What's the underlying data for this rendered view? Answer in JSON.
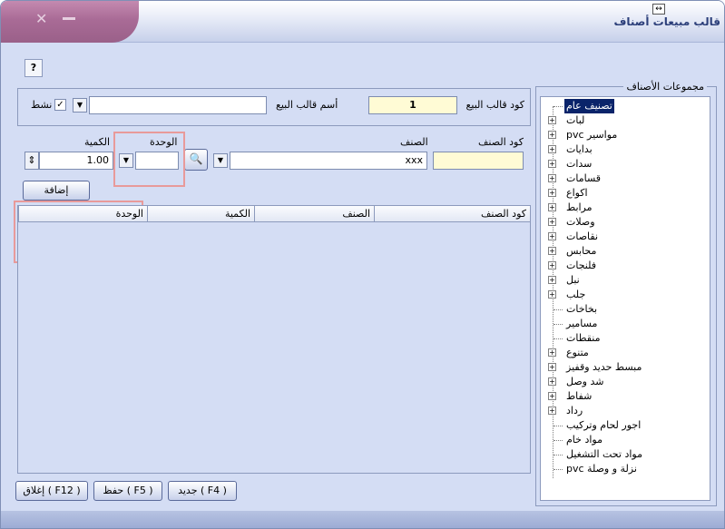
{
  "window": {
    "title": "قالب مبيعات أصناف"
  },
  "help_label": "?",
  "header": {
    "template_code_label": "كود قالب البيع",
    "template_code_value": "1",
    "template_name_label": "أسم قالب البيع",
    "template_name_value": "",
    "active_label": "نشط",
    "active_checked": true,
    "active_check_glyph": "✓"
  },
  "entry": {
    "item_code_label": "كود الصنف",
    "item_code_value": "",
    "item_label": "الصنف",
    "item_value": "xxx",
    "unit_label": "الوحدة",
    "unit_value": "",
    "qty_label": "الكمية",
    "qty_value": "1.00",
    "add_button": "إضافة"
  },
  "grid": {
    "columns": [
      "كود الصنف",
      "الصنف",
      "الكمية",
      "الوحدة"
    ],
    "rows": []
  },
  "groups": {
    "title": "مجموعات الأصناف",
    "items": [
      {
        "label": "تصنيف عام",
        "expandable": false,
        "selected": true
      },
      {
        "label": "لبات",
        "expandable": true
      },
      {
        "label": "مواسير pvc",
        "expandable": true
      },
      {
        "label": "بدايات",
        "expandable": true
      },
      {
        "label": "سدات",
        "expandable": true
      },
      {
        "label": "قسامات",
        "expandable": true
      },
      {
        "label": "اكواع",
        "expandable": true
      },
      {
        "label": "مرابط",
        "expandable": true
      },
      {
        "label": "وصلات",
        "expandable": true
      },
      {
        "label": "نقاصات",
        "expandable": true
      },
      {
        "label": "محابس",
        "expandable": true
      },
      {
        "label": "فلنجات",
        "expandable": true
      },
      {
        "label": "نبل",
        "expandable": true
      },
      {
        "label": "جلب",
        "expandable": true
      },
      {
        "label": "بخاخات",
        "expandable": false
      },
      {
        "label": "مسامير",
        "expandable": false
      },
      {
        "label": "منقطات",
        "expandable": false
      },
      {
        "label": "متنوع",
        "expandable": true
      },
      {
        "label": "مبسط حديد وقفيز",
        "expandable": true
      },
      {
        "label": "شد وصل",
        "expandable": true
      },
      {
        "label": "شفاط",
        "expandable": true
      },
      {
        "label": "رداد",
        "expandable": true
      },
      {
        "label": "اجور لحام وتركيب",
        "expandable": false
      },
      {
        "label": "مواد خام",
        "expandable": false
      },
      {
        "label": "مواد تحت التشغيل",
        "expandable": false
      },
      {
        "label": "نزلة و وصلة pvc",
        "expandable": false
      }
    ]
  },
  "footer": {
    "new_button": "جديد ( F4 )",
    "save_button": "حفظ ( F5 )",
    "close_button": "إغلاق ( F12 )"
  },
  "icons": {
    "dropdown": "▼",
    "search": "🔍",
    "spinner": "⇕",
    "resize": "↔",
    "close": "✕",
    "expand": "+"
  },
  "colors": {
    "window_bg": "#d4ddf4",
    "highlight_box": "#e89a9a",
    "selected_bg": "#0a246a"
  }
}
